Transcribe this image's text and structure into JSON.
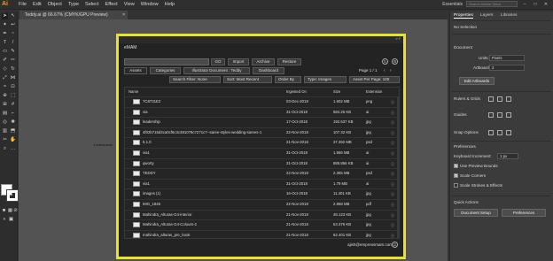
{
  "app": {
    "logo": "Ai",
    "menu": [
      "File",
      "Edit",
      "Object",
      "Type",
      "Select",
      "Effect",
      "View",
      "Window",
      "Help"
    ],
    "workspace": "Essentials",
    "stock_search_placeholder": "Search Adobe Stock",
    "window_controls": [
      "–",
      "□",
      "✕"
    ]
  },
  "document": {
    "tab_title": "Teddy.ai @ 66.67% (CMYK/GPU Preview)",
    "tab_close": "×",
    "canvas_label": "Lorempsum"
  },
  "emam": {
    "title": "eMAM",
    "search_value": "",
    "buttons": {
      "go": "GO",
      "import": "Import",
      "archive": "Archive",
      "restore": "Restore"
    },
    "tabs": [
      "Assets",
      "Categories",
      "Illustrator Document : Teddy",
      "Dashboard"
    ],
    "page_info": "Page 1 / 1",
    "page_prev": "‹",
    "page_next": "›",
    "filters": {
      "search_filter": "Search Filter: None",
      "sort": "Sort: Most Recent",
      "order": "Order By",
      "type": "Type: Images",
      "asset_per_page": "Asset Per Page: 100"
    },
    "columns": {
      "name": "Name",
      "ingested": "Ingested On",
      "size": "Size",
      "extension": "Extension"
    },
    "rows": [
      {
        "name": "7C8731E2",
        "ingested": "03-Dec-2018",
        "size": "1.602 MB",
        "ext": "png"
      },
      {
        "name": "via",
        "ingested": "31-Oct-2018",
        "size": "584.25 KB",
        "ext": "ai"
      },
      {
        "name": "leadership",
        "ingested": "17-Oct-2018",
        "size": "192.637 KB",
        "ext": "jpg"
      },
      {
        "name": "4f02b715d3ca0cf6c3c381078c7271c7--saree-styles-wedding-sarees-1",
        "ingested": "22-Nov-2018",
        "size": "107.32 KB",
        "ext": "jpg"
      },
      {
        "name": "5.1.0",
        "ingested": "21-Nov-2018",
        "size": "37.392 MB",
        "ext": "psd"
      },
      {
        "name": "via1",
        "ingested": "31-Oct-2018",
        "size": "1.566 MB",
        "ext": "ai"
      },
      {
        "name": "qworty",
        "ingested": "31-Oct-2018",
        "size": "889.866 KB",
        "ext": "ai"
      },
      {
        "name": "TEDDY",
        "ingested": "22-Nov-2018",
        "size": "2.355 MB",
        "ext": "psd"
      },
      {
        "name": "via1",
        "ingested": "31-Oct-2018",
        "size": "1.79 MB",
        "ext": "ai"
      },
      {
        "name": "images (1)",
        "ingested": "16-Oct-2018",
        "size": "11.401 KB",
        "ext": "jpg"
      },
      {
        "name": "IMG_1846",
        "ingested": "22-Nov-2018",
        "size": "2.868 MB",
        "ext": "pdf"
      },
      {
        "name": "Mahindra_Alturas-G4-interior",
        "ingested": "21-Nov-2018",
        "size": "48.123 KB",
        "ext": "jpg"
      },
      {
        "name": "Mahindra_Alturas-G4-Colours-2",
        "ingested": "21-Nov-2018",
        "size": "63.376 KB",
        "ext": "jpg"
      },
      {
        "name": "mahindra_alturas_pre_book",
        "ingested": "21-Nov-2018",
        "size": "62.401 KB",
        "ext": "jpg"
      }
    ],
    "user_email": "ajish@empressmam.com"
  },
  "properties": {
    "tabs": [
      "Properties",
      "Layers",
      "Libraries"
    ],
    "no_selection": "No Selection",
    "document_label": "Document",
    "units_label": "Units:",
    "units_value": "Pixels",
    "artboard_label": "Artboard:",
    "artboard_value": "2",
    "edit_artboards": "Edit Artboards",
    "rulers_grids": "Rulers & Grids",
    "guides": "Guides",
    "snap_options": "Snap Options",
    "preferences_label": "Preferences",
    "keyboard_increment_label": "Keyboard Increment:",
    "keyboard_increment_value": "1 px",
    "checkboxes": [
      {
        "label": "Use Preview Bounds",
        "checked": true
      },
      {
        "label": "Scale Corners",
        "checked": true
      },
      {
        "label": "Scale Strokes & Effects",
        "checked": false
      }
    ],
    "quick_actions": "Quick Actions",
    "document_setup": "Document Setup",
    "preferences_button": "Preferences"
  }
}
